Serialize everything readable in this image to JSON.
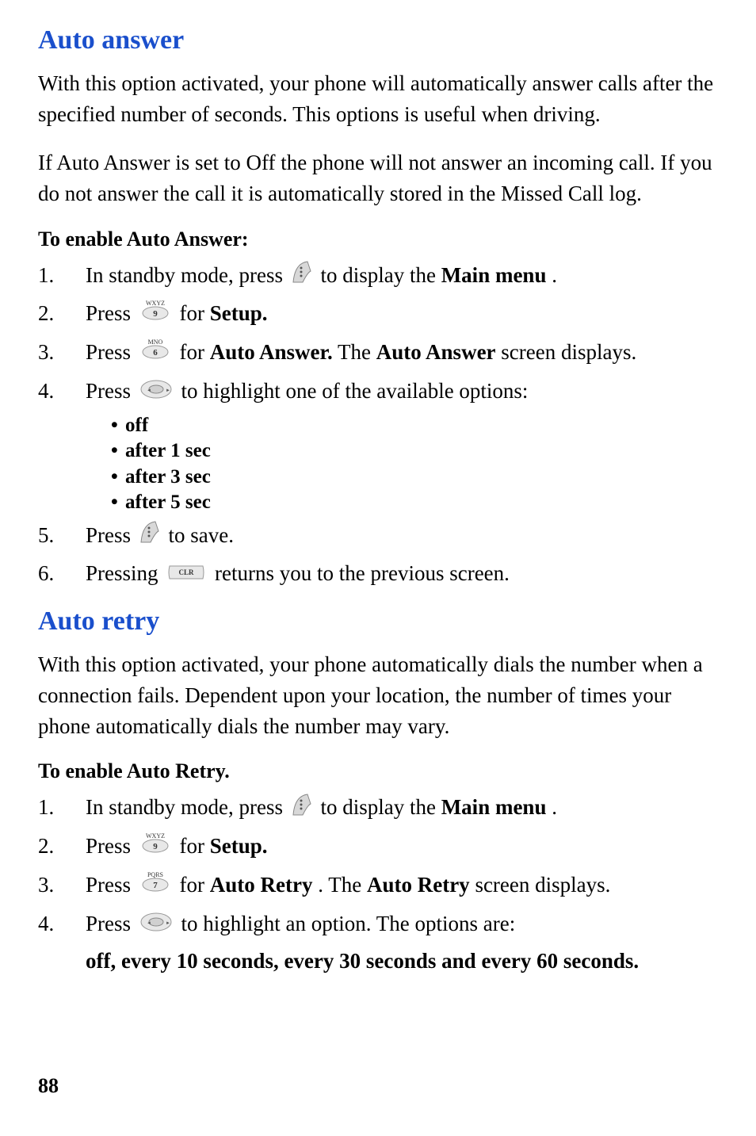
{
  "section1": {
    "heading": "Auto answer",
    "para1": "With this option activated, your phone will automatically answer calls after the specified number of seconds. This options is useful when driving.",
    "para2": "If Auto Answer is set to Off the phone will not answer an incoming call. If you do not answer the call it is automatically stored in the Missed Call log.",
    "subheading": "To enable Auto Answer:",
    "steps": {
      "s1_a": "In standby mode, press ",
      "s1_b": " to display the ",
      "s1_c": "Main menu",
      "s1_d": ".",
      "s2_a": "Press ",
      "s2_b": " for ",
      "s2_c": "Setup.",
      "s3_a": "Press ",
      "s3_b": " for ",
      "s3_c": "Auto Answer.",
      "s3_d": " The ",
      "s3_e": "Auto Answer",
      "s3_f": " screen displays.",
      "s4_a": "Press",
      "s4_b": "to highlight one of the available options:",
      "s5_a": "Press ",
      "s5_b": " to save.",
      "s6_a": "Pressing ",
      "s6_b": " returns you to the previous screen."
    },
    "bullets": [
      "off",
      "after 1 sec",
      "after 3 sec",
      "after 5 sec"
    ]
  },
  "section2": {
    "heading": "Auto retry",
    "para1": "With this option activated, your phone automatically dials the number when a connection fails. Dependent upon your location, the number of times your phone automatically dials the number may vary.",
    "subheading": "To enable Auto Retry.",
    "steps": {
      "s1_a": "In standby mode, press ",
      "s1_b": " to display the ",
      "s1_c": "Main menu",
      "s1_d": ".",
      "s2_a": "Press ",
      "s2_b": " for ",
      "s2_c": "Setup.",
      "s3_a": "Press ",
      "s3_b": " for ",
      "s3_c": "Auto Retry",
      "s3_d": ". The ",
      "s3_e": "Auto Retry",
      "s3_f": " screen displays.",
      "s4_a": "Press",
      "s4_b": "to highlight an option. The options are:",
      "s4_c": "off, every 10 seconds, every 30 seconds and every 60 seconds."
    }
  },
  "nums": {
    "n1": "1.",
    "n2": "2.",
    "n3": "3.",
    "n4": "4.",
    "n5": "5.",
    "n6": "6."
  },
  "bullet": "•",
  "pageNum": "88"
}
